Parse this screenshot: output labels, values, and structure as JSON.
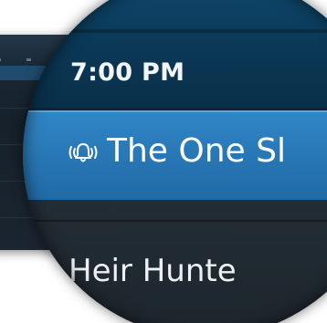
{
  "guide": {
    "time_slot": "7:00 PM",
    "selected_program": {
      "title": "The One Sl",
      "reminder_icon": "bell-reminder-icon"
    },
    "next_program": {
      "title": "Heir Hunte"
    }
  },
  "colors": {
    "header_blue": "#0b3856",
    "selected_blue": "#2a7bbb",
    "row_dark": "#232d35",
    "text_white": "#ffffff"
  }
}
